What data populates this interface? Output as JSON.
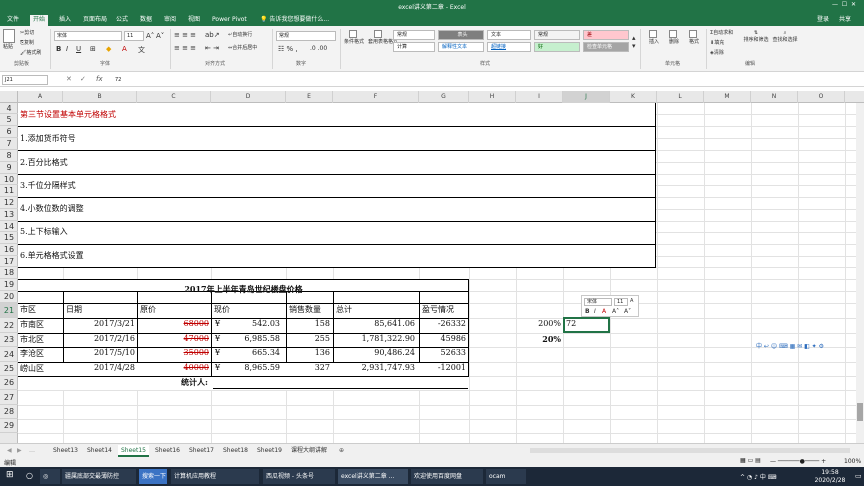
{
  "window": {
    "title": "excel讲义第二章 - Excel",
    "login": "登录",
    "share": "共享"
  },
  "tabs": [
    "文件",
    "开始",
    "插入",
    "页面布局",
    "公式",
    "数据",
    "审阅",
    "视图",
    "Power Pivot"
  ],
  "tell_me": "告诉我您想要做什么...",
  "ribbon": {
    "paste": "粘贴",
    "cut": "剪切",
    "copy": "复制",
    "format_painter": "格式刷",
    "clipboard": "剪贴板",
    "font_name": "宋体",
    "font_size": "11",
    "font_group": "字体",
    "wrap_text": "自动换行",
    "merge_center": "合并后居中",
    "alignment": "对齐方式",
    "number_format": "常规",
    "number_group": "数字",
    "conditional": "条件格式",
    "table_format": "套用表格格式",
    "styles_group": "样式",
    "style_normal": "常规",
    "style_bad": "差",
    "style_good": "好",
    "style_neutral": "适中",
    "style_calc": "计算",
    "style_check": "检查单元格",
    "style_explain": "解释性文本",
    "style_warn": "警告文本",
    "style_link": "链接单元格",
    "style_output": "输出",
    "style_title": "表头",
    "style_text": "文本",
    "style_hyper": "超链接",
    "insert": "插入",
    "delete": "删除",
    "format": "格式",
    "cells_group": "单元格",
    "autosum": "自动求和",
    "fill": "填充",
    "clear": "清除",
    "sort": "排序和筛选",
    "find": "查找和选择",
    "editing_group": "编辑"
  },
  "name_box": "J21",
  "formula": "72",
  "columns": [
    "A",
    "B",
    "C",
    "D",
    "E",
    "F",
    "G",
    "H",
    "I",
    "J",
    "K",
    "L",
    "M",
    "N",
    "O"
  ],
  "rows": [
    "4",
    "5",
    "6",
    "7",
    "8",
    "9",
    "10",
    "11",
    "12",
    "13",
    "14",
    "15",
    "16",
    "17",
    "18",
    "19",
    "20",
    "21",
    "22",
    "23",
    "24",
    "25",
    "26",
    "27",
    "28",
    "29"
  ],
  "heading": "第三节设置基本单元格格式",
  "list": [
    "1.添加货币符号",
    "2.百分比格式",
    "3.千位分隔样式",
    "4.小数位数的调整",
    "5.上下标输入",
    "6.单元格格式设置"
  ],
  "table": {
    "title": "2017年上半年青岛世纪楼盘价格",
    "headers": [
      "市区",
      "日期",
      "原价",
      "现价",
      "销售数量",
      "总计",
      "盈亏情况"
    ],
    "rows": [
      [
        "市南区",
        "2017/3/21",
        "68000",
        "¥",
        "542.03",
        "158",
        "85,641.06",
        "-26332"
      ],
      [
        "市北区",
        "2017/2/16",
        "47000",
        "¥",
        "6,985.58",
        "255",
        "1,781,322.90",
        "45986"
      ],
      [
        "李沧区",
        "2017/5/10",
        "35000",
        "¥",
        "665.34",
        "136",
        "90,486.24",
        "52633"
      ],
      [
        "崂山区",
        "2017/4/28",
        "40000",
        "¥",
        "8,965.59",
        "327",
        "2,931,747.93",
        "-12001"
      ]
    ],
    "signer": "统计人:"
  },
  "side": {
    "i21": "200%",
    "j21": "72",
    "i22": "20%"
  },
  "mini_toolbar": {
    "font": "宋体",
    "size": "11"
  },
  "sheets": [
    "Sheet13",
    "Sheet14",
    "Sheet15",
    "Sheet16",
    "Sheet17",
    "Sheet18",
    "Sheet19",
    "课程大纲讲解"
  ],
  "active_sheet": "Sheet15",
  "status": "编辑",
  "zoom": "100%",
  "taskbar": {
    "search": "搜索一下",
    "apps": [
      "疆属底部交最薄防控",
      "计算机应用教程",
      "西瓜视频 - 头条号",
      "excel讲义第二章 ...",
      "欢迎使用百度网盘",
      "ocam"
    ],
    "time": "19:58",
    "date": "2020/2/28"
  },
  "colors": {
    "accent": "#217346",
    "red": "#c00000"
  }
}
